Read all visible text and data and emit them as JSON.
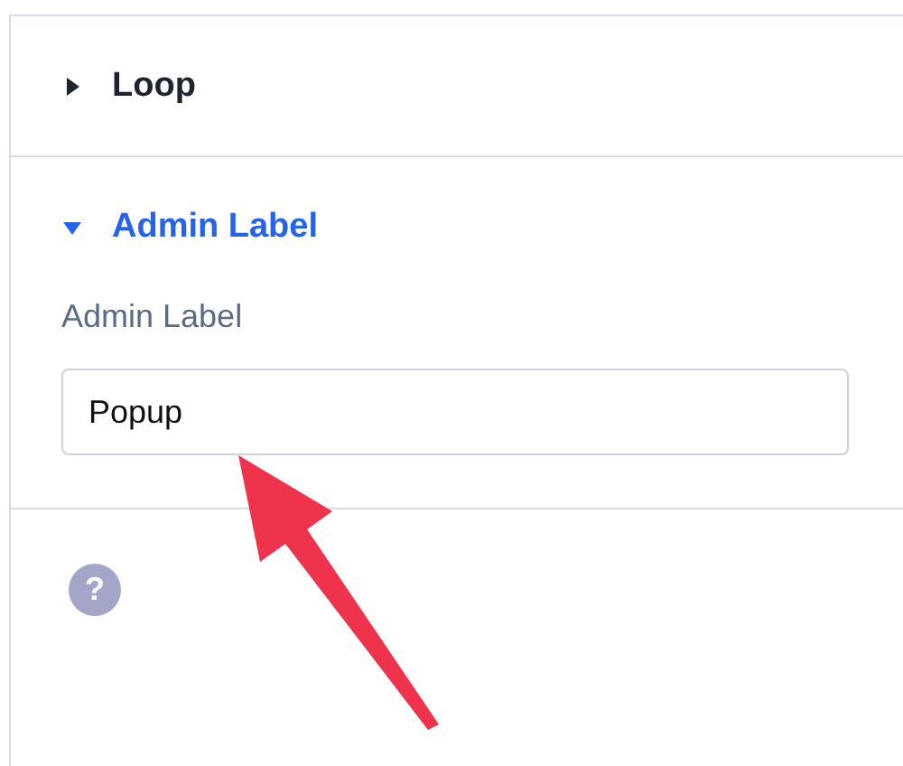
{
  "sections": [
    {
      "title": "Loop",
      "expanded": false
    },
    {
      "title": "Admin Label",
      "expanded": true,
      "field": {
        "label": "Admin Label",
        "value": "Popup"
      }
    }
  ],
  "help": {
    "icon": "?"
  },
  "annotation": {
    "kind": "arrow"
  }
}
